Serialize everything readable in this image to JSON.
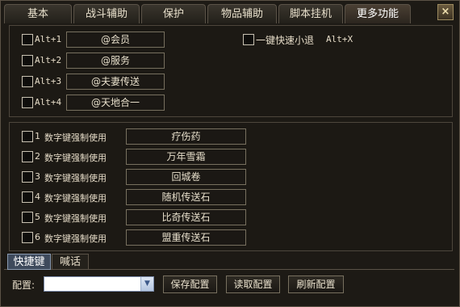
{
  "tabs": [
    "基本",
    "战斗辅助",
    "保护",
    "物品辅助",
    "脚本挂机",
    "更多功能"
  ],
  "close_label": "×",
  "alt_rows": [
    {
      "key": "Alt+1",
      "value": "@会员"
    },
    {
      "key": "Alt+2",
      "value": "@服务"
    },
    {
      "key": "Alt+3",
      "value": "@夫妻传送"
    },
    {
      "key": "Alt+4",
      "value": "@天地合一"
    }
  ],
  "quick_exit": {
    "label": "一键快速小退",
    "hotkey": "Alt+X"
  },
  "num_rows": [
    {
      "num": "1",
      "label": "数字键强制使用",
      "item": "疗伤药"
    },
    {
      "num": "2",
      "label": "数字键强制使用",
      "item": "万年雪霜"
    },
    {
      "num": "3",
      "label": "数字键强制使用",
      "item": "回城卷"
    },
    {
      "num": "4",
      "label": "数字键强制使用",
      "item": "随机传送石"
    },
    {
      "num": "5",
      "label": "数字键强制使用",
      "item": "比奇传送石"
    },
    {
      "num": "6",
      "label": "数字键强制使用",
      "item": "盟重传送石"
    }
  ],
  "bottom_tabs": [
    "快捷键",
    "喊话"
  ],
  "config": {
    "label": "配置:",
    "value": "",
    "save": "保存配置",
    "load": "读取配置",
    "refresh": "刷新配置"
  },
  "colors": {
    "accent": "#4a3f33",
    "select_border": "#7a8aa8"
  }
}
